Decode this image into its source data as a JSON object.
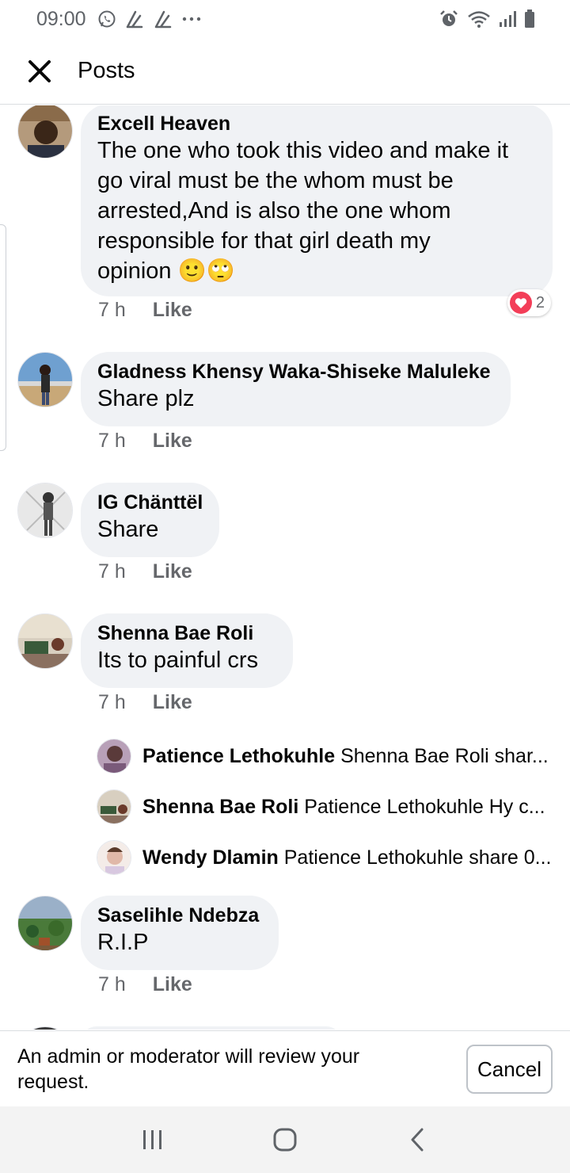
{
  "status_bar": {
    "time": "09:00",
    "left_icons": [
      "whatsapp-icon",
      "notification-icon",
      "notification-icon",
      "more-dots-icon"
    ],
    "right_icons": [
      "alarm-icon",
      "wifi-icon",
      "signal-icon",
      "battery-icon"
    ]
  },
  "header": {
    "title": "Posts",
    "close_icon": "close-icon"
  },
  "comments": [
    {
      "author": "Excell Heaven",
      "lines": [
        "The one who took this video and make it",
        "go viral must be the whom must be",
        "arrested,And is also  the one whom",
        "responsible  for that girl death my",
        "opinion 🙂🙄"
      ],
      "time": "7 h",
      "like_label": "Like",
      "reaction_count": "2",
      "avatar_color": "#8a6b4a"
    },
    {
      "author": "Gladness Khensy Waka-Shiseke Maluleke",
      "lines": [
        "Share plz"
      ],
      "time": "7 h",
      "like_label": "Like",
      "avatar_color": "#3a5a8a"
    },
    {
      "author": "IG Chänttël",
      "lines": [
        "Share"
      ],
      "time": "7 h",
      "like_label": "Like",
      "avatar_color": "#9a9a9a"
    },
    {
      "author": "Shenna Bae Roli",
      "lines": [
        "Its to painful crs"
      ],
      "time": "7 h",
      "like_label": "Like",
      "avatar_color": "#6a7a5a",
      "replies": [
        {
          "author": "Patience Lethokuhle",
          "text": "Shenna Bae Roli shar...",
          "avatar_color": "#7a6a8a"
        },
        {
          "author": "Shenna Bae Roli",
          "text": "Patience Lethokuhle Hy c...",
          "avatar_color": "#6a7a5a"
        },
        {
          "author": "Wendy Dlamin",
          "text": "Patience Lethokuhle share 0...",
          "avatar_color": "#d8b8b0"
        }
      ]
    },
    {
      "author": "Saselihle Ndebza",
      "lines": [
        "R.I.P"
      ],
      "time": "7 h",
      "like_label": "Like",
      "avatar_color": "#4a7a3a"
    }
  ],
  "notice": {
    "text": "An admin or moderator will review your request.",
    "cancel_label": "Cancel"
  },
  "nav_bar": {
    "icons": [
      "recent-apps-icon",
      "home-icon",
      "back-icon"
    ]
  },
  "colors": {
    "bubble": "#f0f2f5",
    "muted_text": "#65676b",
    "divider": "#dadde1",
    "reaction_heart": "#f33e58"
  }
}
